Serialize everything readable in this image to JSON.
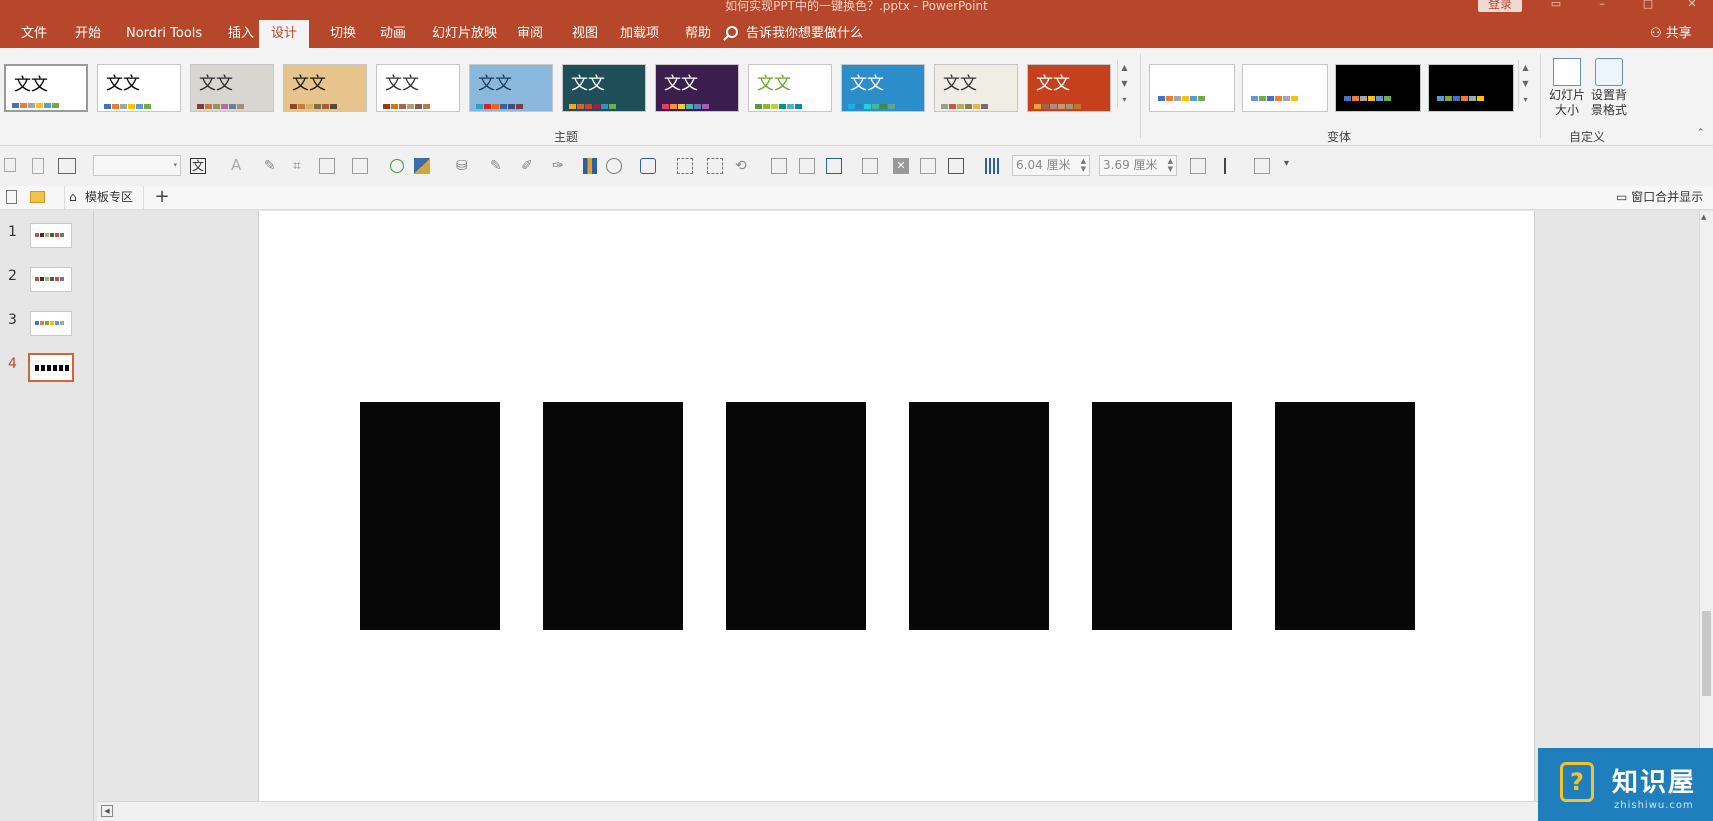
{
  "window": {
    "title": "如何实现PPT中的一键换色？.pptx  -  PowerPoint",
    "login": "登录"
  },
  "tabs": [
    "文件",
    "开始",
    "Nordri Tools",
    "插入",
    "设计",
    "切换",
    "动画",
    "幻灯片放映",
    "审阅",
    "视图",
    "加载项",
    "帮助"
  ],
  "active_tab": "设计",
  "tell_me": "告诉我你想要做什么",
  "share": "共享",
  "ribbon": {
    "themes_label": "主题",
    "theme_sample_text": "文文",
    "variants_label": "变体",
    "customize_label": "自定义",
    "slide_size": "幻灯片大小",
    "format_background": "设置背景格式",
    "themes": [
      {
        "bg": "#ffffff",
        "fg": "#000000",
        "swatches": [
          "#4472c4",
          "#ed7d31",
          "#a5a5a5",
          "#ffc000",
          "#5b9bd5",
          "#70ad47"
        ]
      },
      {
        "bg": "#ffffff",
        "fg": "#000000",
        "swatches": [
          "#4472c4",
          "#ed7d31",
          "#a5a5a5",
          "#ffc000",
          "#5b9bd5",
          "#70ad47"
        ]
      },
      {
        "bg": "#d9d6d2",
        "fg": "#2b2b2b",
        "swatches": [
          "#8c3b3b",
          "#c07a3d",
          "#9a8f5f",
          "#b46ca5",
          "#6a7f9d",
          "#a58f78"
        ]
      },
      {
        "bg": "#e7c48c",
        "fg": "#1a1a1a",
        "swatches": [
          "#8e4b21",
          "#c67f3a",
          "#d6ae65",
          "#7b6e44",
          "#a75b36",
          "#58472c"
        ]
      },
      {
        "bg": "#ffffff",
        "fg": "#333333",
        "swatches": [
          "#9e3611",
          "#c77c0e",
          "#a5644e",
          "#b19c7d",
          "#7f5f52",
          "#b27d49"
        ]
      },
      {
        "bg": "#8ab8dc",
        "fg": "#1a3a5c",
        "swatches": [
          "#2da2bf",
          "#da1f28",
          "#eb641b",
          "#39639d",
          "#474b78",
          "#7d3c4a"
        ]
      },
      {
        "bg": "#1e4e57",
        "fg": "#ffffff",
        "swatches": [
          "#f2a82b",
          "#d9622b",
          "#e4372c",
          "#9c1f4a",
          "#3d8eb9",
          "#6ab04c"
        ]
      },
      {
        "bg": "#3b1e4d",
        "fg": "#ffffff",
        "swatches": [
          "#e33d6f",
          "#f5913c",
          "#f7c93a",
          "#54b5a6",
          "#5d7fc2",
          "#a35fb2"
        ]
      },
      {
        "bg": "#ffffff",
        "fg": "#6aa62c",
        "swatches": [
          "#549e39",
          "#8ab833",
          "#c0cf3a",
          "#029676",
          "#4ab5c4",
          "#0989b1"
        ]
      },
      {
        "bg": "#2b8dc9",
        "fg": "#ffffff",
        "swatches": [
          "#1cade4",
          "#2683c6",
          "#27ced7",
          "#42ba97",
          "#3e8853",
          "#62a39f"
        ]
      },
      {
        "bg": "#f0ede4",
        "fg": "#333333",
        "swatches": [
          "#93a299",
          "#cf543f",
          "#b5ae53",
          "#848058",
          "#e8b54d",
          "#786c71"
        ]
      },
      {
        "bg": "#c7401d",
        "fg": "#ffffff",
        "swatches": [
          "#f0a22e",
          "#a5644e",
          "#b58b80",
          "#c3986d",
          "#a19574",
          "#c17529"
        ]
      }
    ],
    "variants": [
      {
        "dark": false,
        "swatches": [
          "#4472c4",
          "#ed7d31",
          "#a5a5a5",
          "#ffc000",
          "#5b9bd5",
          "#70ad47"
        ]
      },
      {
        "dark": false,
        "swatches": [
          "#5b9bd5",
          "#70ad47",
          "#4472c4",
          "#ed7d31",
          "#a5a5a5",
          "#ffc000"
        ]
      },
      {
        "dark": true,
        "swatches": [
          "#4472c4",
          "#ed7d31",
          "#a5a5a5",
          "#ffc000",
          "#5b9bd5",
          "#70ad47"
        ]
      },
      {
        "dark": true,
        "swatches": [
          "#5b9bd5",
          "#70ad47",
          "#4472c4",
          "#ed7d31",
          "#a5a5a5",
          "#ffc000"
        ]
      }
    ]
  },
  "toolbar": {
    "width_value": "6.04 厘米",
    "height_value": "3.69 厘米"
  },
  "doc_tabs": {
    "template_zone": "模板专区",
    "merge_windows": "窗口合并显示"
  },
  "slides": [
    {
      "number": "1",
      "active": false
    },
    {
      "number": "2",
      "active": false
    },
    {
      "number": "3",
      "active": false
    },
    {
      "number": "4",
      "active": true
    }
  ],
  "slide_content": {
    "rectangle_count": 6,
    "rectangle_color": "#070707"
  },
  "watermark": {
    "name": "知识屋",
    "url": "zhishiwu.com"
  }
}
